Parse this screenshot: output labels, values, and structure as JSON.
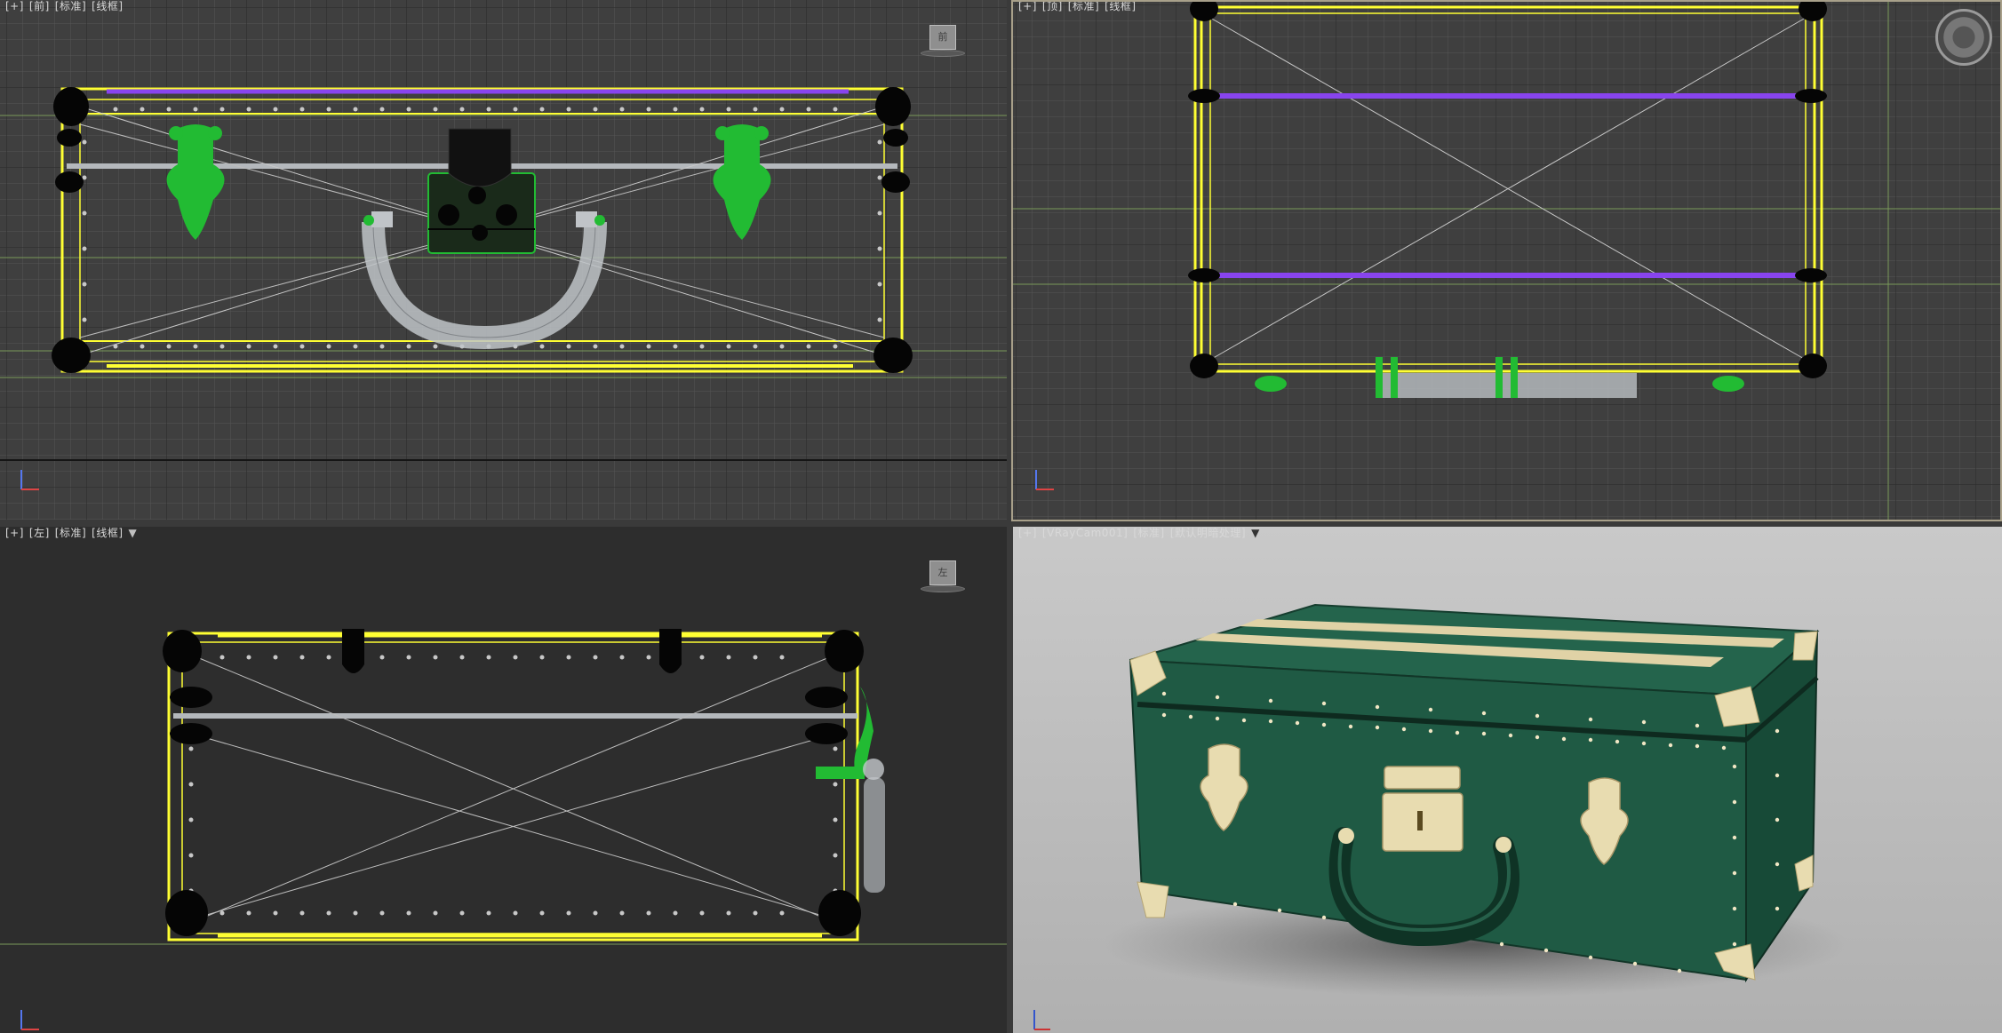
{
  "viewports": {
    "front": {
      "label_parts": [
        "[+]",
        "[前]",
        "[标准]",
        "[线框]"
      ],
      "cube_label": "前"
    },
    "top": {
      "label_parts": [
        "[+]",
        "[顶]",
        "[标准]",
        "[线框]"
      ]
    },
    "left": {
      "label_parts": [
        "[+]",
        "[左]",
        "[标准]",
        "[线框]"
      ],
      "cube_label": "左"
    },
    "camera": {
      "label_parts": [
        "[+]",
        "[VRayCam001]",
        "[标准]",
        "[默认明暗处理]"
      ]
    }
  },
  "colors": {
    "wire_yellow": "#ffff33",
    "wire_purple": "#8844ee",
    "wire_green": "#22bb33",
    "wire_gray": "#b4b8bc",
    "wire_black": "#050505",
    "grid_bg": "#3f3f3f",
    "camera_bg": "#b8b8b8",
    "case_green": "#1e5a45",
    "brass": "#e8dcb0"
  },
  "icons": {
    "filter": "filter-icon",
    "nav": "navigation-wheel-icon"
  }
}
